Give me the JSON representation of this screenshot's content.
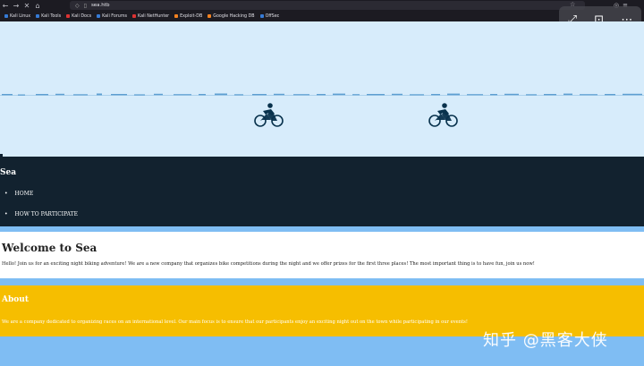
{
  "browser": {
    "url": "sea.htb",
    "nav_back": "←",
    "nav_forward": "→",
    "nav_close": "✕",
    "nav_home": "⌂",
    "bookmarks": [
      {
        "label": "Kali Linux",
        "color": "#367bd6"
      },
      {
        "label": "Kali Tools",
        "color": "#367bd6"
      },
      {
        "label": "Kali Docs",
        "color": "#d33"
      },
      {
        "label": "Kali Forums",
        "color": "#367bd6"
      },
      {
        "label": "Kali NetHunter",
        "color": "#d33"
      },
      {
        "label": "Exploit-DB",
        "color": "#f58220"
      },
      {
        "label": "Google Hacking DB",
        "color": "#f58220"
      },
      {
        "label": "OffSec",
        "color": "#367bd6"
      }
    ]
  },
  "overlay": {
    "expand": "⤢",
    "capture": "⊡",
    "more": "⋯"
  },
  "header": {
    "title": "Sea",
    "nav": [
      {
        "label": "HOME"
      },
      {
        "label": "HOW TO PARTICIPATE"
      }
    ]
  },
  "welcome": {
    "heading": "Welcome to Sea",
    "text": "Hello! Join us for an exciting night biking adventure! We are a new company that organizes bike competitions during the night and we offer prizes for the first three places! The most important thing is to have fun, join us now!"
  },
  "about": {
    "heading": "About",
    "text": "We are a company dedicated to organizing races on an international level. Our main focus is to ensure that our participants enjoy an exciting night out on the town while participating in our events!"
  },
  "watermark": "知乎 @黑客大侠",
  "colors": {
    "hero_bg": "#d7ecfb",
    "header_bg": "#12222f",
    "about_bg": "#f6be00",
    "band": "#7fbdf3"
  }
}
